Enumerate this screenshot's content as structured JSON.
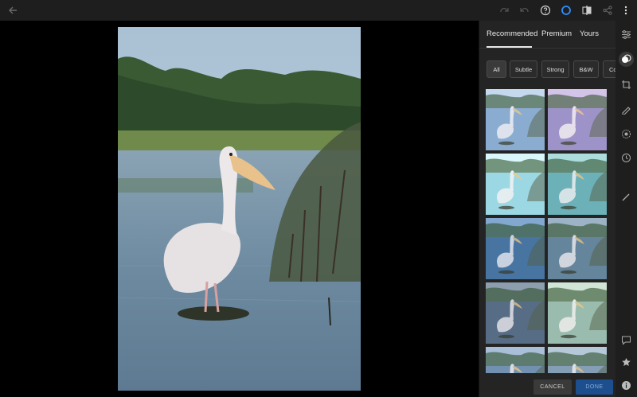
{
  "topbar": {
    "icons": [
      "back-arrow-icon",
      "redo-icon",
      "undo-icon",
      "help-icon",
      "edit-circle-icon",
      "compare-icon",
      "share-icon",
      "more-icon"
    ]
  },
  "panel": {
    "tabs": [
      {
        "label": "Recommended",
        "active": true
      },
      {
        "label": "Premium",
        "active": false
      },
      {
        "label": "Yours",
        "active": false
      }
    ],
    "chips": [
      {
        "label": "All",
        "active": true
      },
      {
        "label": "Subtle",
        "active": false
      },
      {
        "label": "Strong",
        "active": false
      },
      {
        "label": "B&W",
        "active": false
      },
      {
        "label": "Co",
        "active": false
      }
    ],
    "thumbnails": [
      {
        "tint": "#a9c6e6",
        "sky": "#cfe0f2",
        "water": "#7fa3c8"
      },
      {
        "tint": "#c7b7e0",
        "sky": "#d8c8ee",
        "water": "#8f86c0"
      },
      {
        "tint": "#c2ecf0",
        "sky": "#e4fbff",
        "water": "#8ed0e0"
      },
      {
        "tint": "#8fc9cc",
        "sky": "#b8e4e2",
        "water": "#5fa7b0"
      },
      {
        "tint": "#5e87b6",
        "sky": "#90b5d8",
        "water": "#3f6c99"
      },
      {
        "tint": "#7f9bb0",
        "sky": "#a7bdcc",
        "water": "#5c7d95"
      },
      {
        "tint": "#6d8399",
        "sky": "#9aa9b8",
        "water": "#50667d"
      },
      {
        "tint": "#b7d3c2",
        "sky": "#dbece0",
        "water": "#8fb3a7"
      },
      {
        "tint": "#8aa6c4",
        "sky": "#b4c9de",
        "water": "#6a8aaa"
      },
      {
        "tint": "#99b2c8",
        "sky": "#c1d2e0",
        "water": "#7a96ae"
      }
    ],
    "footer": {
      "cancel_label": "CANCEL",
      "done_label": "DONE"
    }
  },
  "rail": {
    "icons": [
      "adjust-sliders-icon",
      "presets-icon",
      "crop-icon",
      "healing-brush-icon",
      "selective-icon",
      "history-icon",
      "brush-icon",
      "comment-icon",
      "star-icon",
      "info-icon"
    ],
    "active": "presets-icon"
  },
  "colors": {
    "accent": "#1d4f8f",
    "active_ring": "#2f8fff"
  }
}
